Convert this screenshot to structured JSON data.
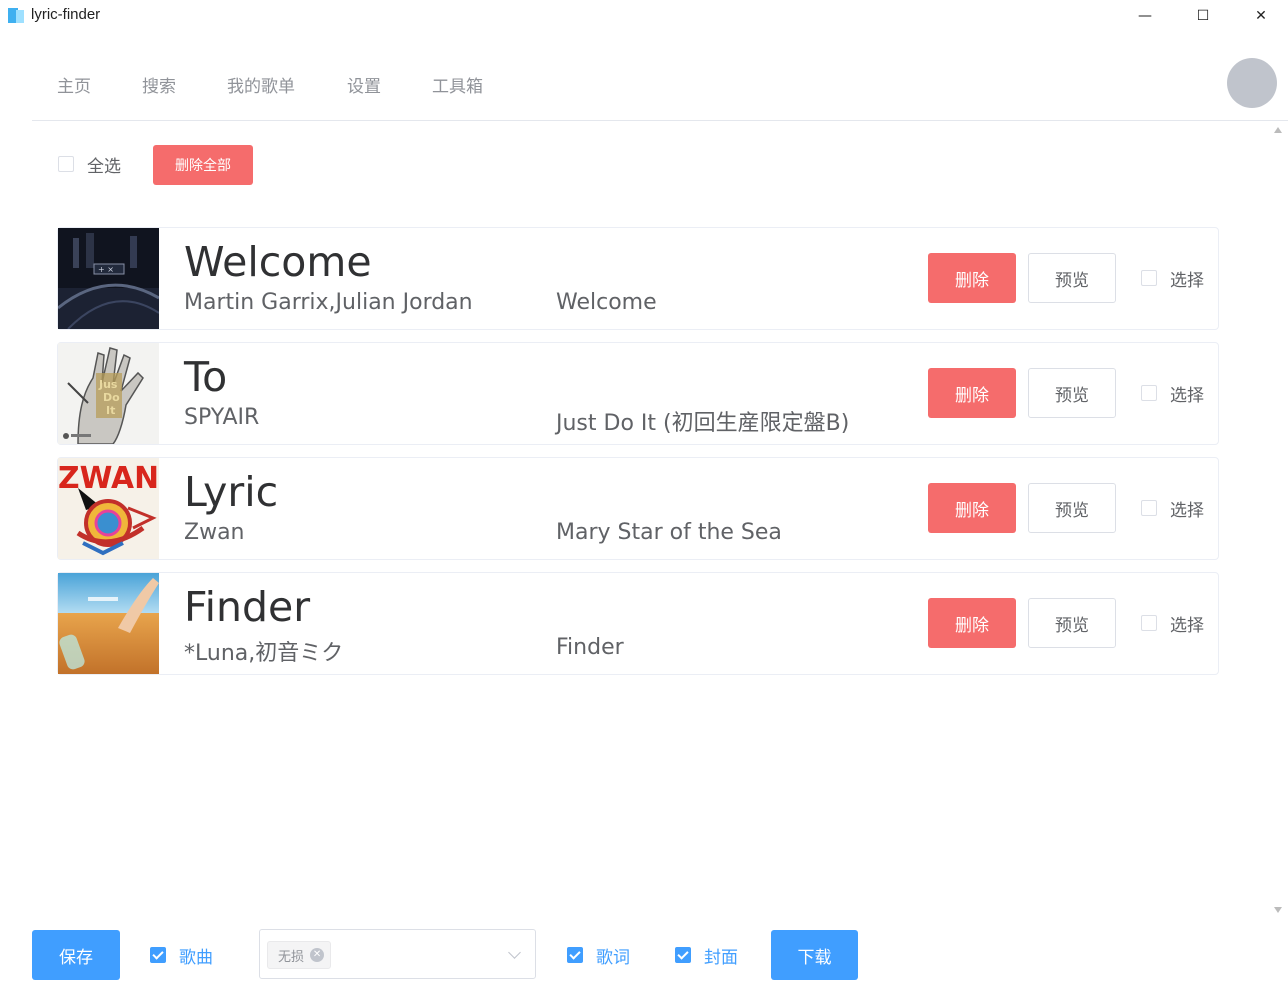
{
  "window": {
    "title": "lyric-finder",
    "min_glyph": "—",
    "max_glyph": "☐",
    "close_glyph": "✕"
  },
  "nav": {
    "items": [
      "主页",
      "搜索",
      "我的歌单",
      "设置",
      "工具箱"
    ]
  },
  "toolbar": {
    "select_all_label": "全选",
    "delete_all_label": "删除全部"
  },
  "songs": [
    {
      "title": "Welcome",
      "artist": "Martin Garrix,Julian Jordan",
      "album": "Welcome",
      "delete_label": "删除",
      "preview_label": "预览",
      "select_label": "选择"
    },
    {
      "title": "To",
      "artist": "SPYAIR",
      "album": "Just Do It (初回生産限定盤B)",
      "delete_label": "删除",
      "preview_label": "预览",
      "select_label": "选择"
    },
    {
      "title": "Lyric",
      "artist": "Zwan",
      "album": "Mary Star of the Sea",
      "delete_label": "删除",
      "preview_label": "预览",
      "select_label": "选择"
    },
    {
      "title": "Finder",
      "artist": "*Luna,初音ミク",
      "album": "Finder",
      "delete_label": "删除",
      "preview_label": "预览",
      "select_label": "选择"
    }
  ],
  "bottom": {
    "save_label": "保存",
    "song_label": "歌曲",
    "song_checked": true,
    "quality_tag": "无损",
    "lyric_label": "歌词",
    "lyric_checked": true,
    "cover_label": "封面",
    "cover_checked": true,
    "download_label": "下载"
  },
  "colors": {
    "danger": "#f56c6c",
    "primary": "#409eff",
    "avatar": "#c0c4cc"
  }
}
